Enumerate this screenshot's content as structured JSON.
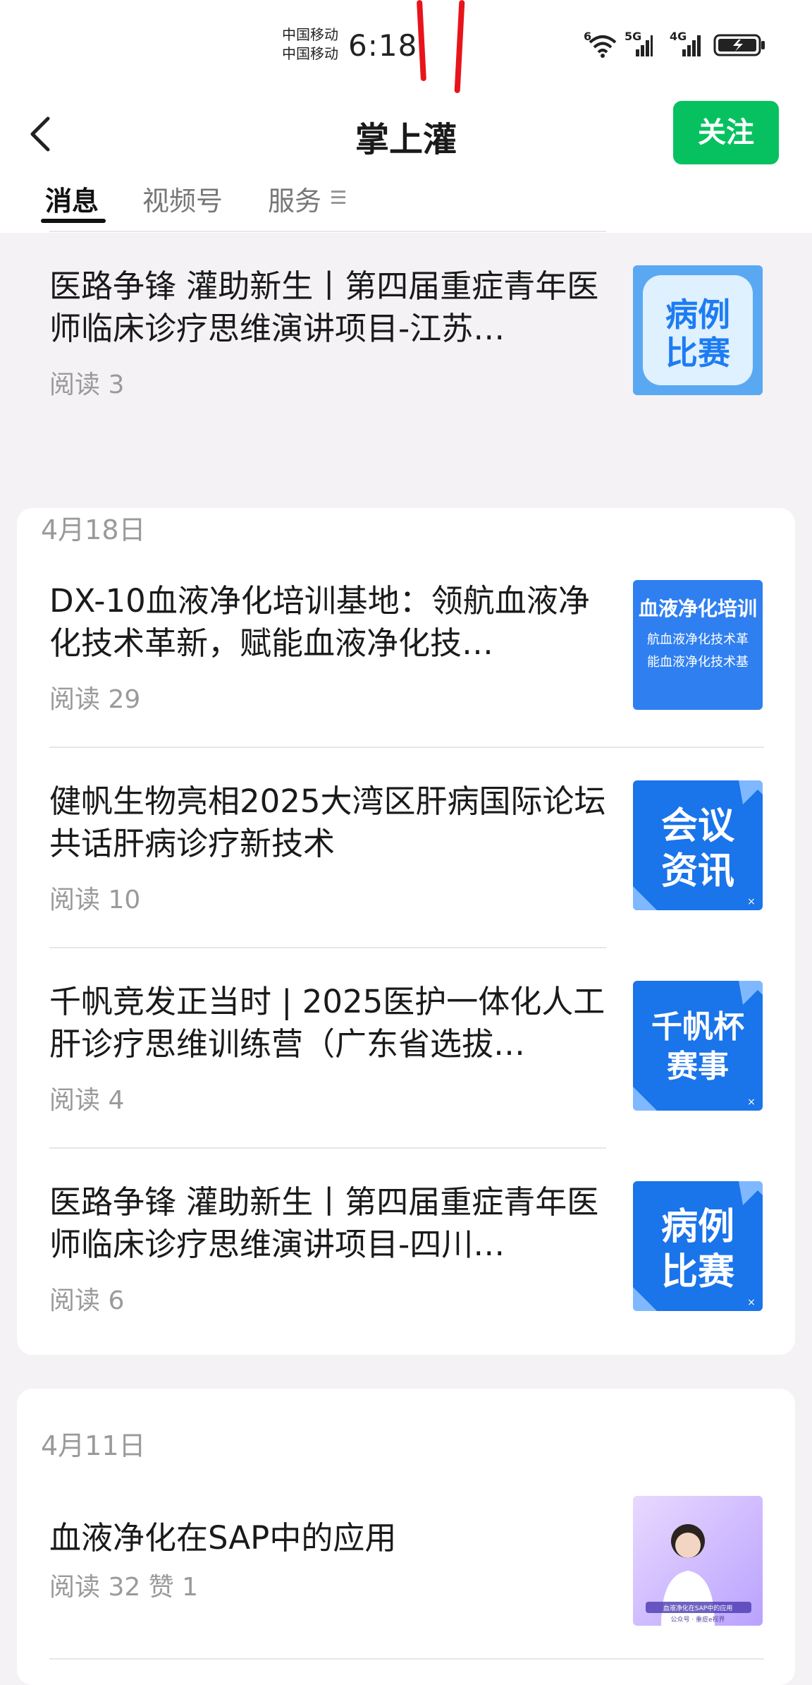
{
  "status_bar": {
    "carrier_1": "中国移动",
    "carrier_2": "中国移动",
    "time": "6:18",
    "net_wifi": "6",
    "net_5g": "5G",
    "net_4g": "4G"
  },
  "header": {
    "title": "掌上灌",
    "follow_label": "关注"
  },
  "tabs": [
    {
      "label": "消息",
      "active": true
    },
    {
      "label": "视频号",
      "active": false
    },
    {
      "label": "服务",
      "active": false
    }
  ],
  "colors": {
    "accent_green": "#07c160",
    "thumb_blue": "#1d7cf2",
    "annotation_red": "#e8141b"
  },
  "first_article": {
    "title": "医路争锋 灌助新生丨第四届重症青年医师临床诊疗思维演讲项目-江苏…",
    "reads": "阅读 3",
    "thumb_text": [
      "病例",
      "比赛"
    ]
  },
  "groups": [
    {
      "date": "4月18日",
      "articles": [
        {
          "title": "DX-10血液净化培训基地：领航血液净化技术革新，赋能血液净化技…",
          "reads": "阅读 29",
          "thumb_text": [
            "血液净化培训",
            "航血液净化技术革",
            "能血液净化技术基"
          ]
        },
        {
          "title": "健帆生物亮相2025大湾区肝病国际论坛 共话肝病诊疗新技术",
          "reads": "阅读 10",
          "thumb_text": [
            "会议",
            "资讯"
          ]
        },
        {
          "title": "千帆竞发正当时 | 2025医护一体化人工肝诊疗思维训练营（广东省选拔…",
          "reads": "阅读 4",
          "thumb_text": [
            "千帆杯",
            "赛事"
          ]
        },
        {
          "title": "医路争锋 灌助新生丨第四届重症青年医师临床诊疗思维演讲项目-四川…",
          "reads": "阅读 6",
          "thumb_text": [
            "病例",
            "比赛"
          ]
        }
      ]
    },
    {
      "date": "4月11日",
      "articles": [
        {
          "title": "血液净化在SAP中的应用",
          "reads": "阅读 32   赞 1",
          "thumb_text": [
            "血液净化在SAP中的应用",
            "公众号 · 重症e视界"
          ]
        }
      ]
    }
  ]
}
